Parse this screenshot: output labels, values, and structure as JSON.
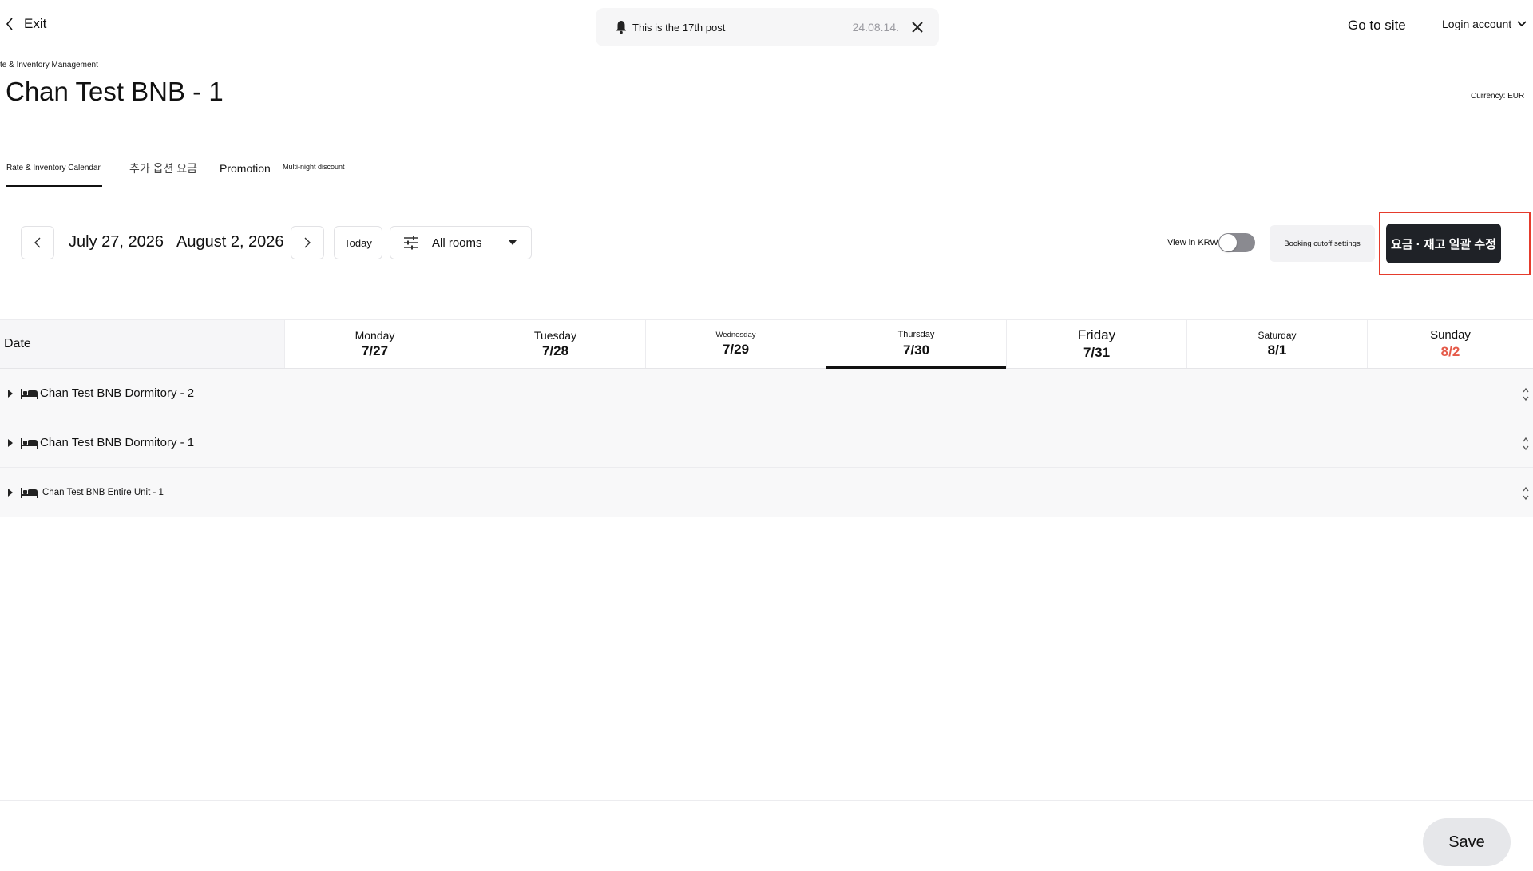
{
  "header": {
    "exit_label": "Exit",
    "notice_text": "This is the 17th post",
    "notice_date": "24.08.14.",
    "go_to_site": "Go to site",
    "login_account": "Login account"
  },
  "page": {
    "breadcrumb": "te & Inventory Management",
    "title": "Chan Test BNB - 1",
    "currency": "Currency: EUR"
  },
  "tabs": [
    {
      "label": "Rate & Inventory Calendar",
      "active": true
    },
    {
      "label": "추가 옵션 요금"
    },
    {
      "label": "Promotion"
    },
    {
      "label": "Multi-night discount"
    }
  ],
  "toolbar": {
    "range_start": "July 27, 2026",
    "range_end": "August 2, 2026",
    "today_label": "Today",
    "rooms_label": "All rooms",
    "view_krw_label": "View in KRW",
    "view_krw_on": false,
    "cutoff_label": "Booking cutoff settings",
    "bulk_edit_label": "요금 · 재고 일괄 수정"
  },
  "grid": {
    "date_header": "Date",
    "days": [
      {
        "name": "Monday",
        "date": "7/27"
      },
      {
        "name": "Tuesday",
        "date": "7/28"
      },
      {
        "name": "Wednesday",
        "date": "7/29"
      },
      {
        "name": "Thursday",
        "date": "7/30",
        "selected": true
      },
      {
        "name": "Friday",
        "date": "7/31"
      },
      {
        "name": "Saturday",
        "date": "8/1"
      },
      {
        "name": "Sunday",
        "date": "8/2"
      }
    ],
    "rooms": [
      {
        "name": "Chan Test BNB Dormitory - 2"
      },
      {
        "name": "Chan Test BNB Dormitory - 1"
      },
      {
        "name": "Chan Test BNB Entire Unit - 1"
      }
    ]
  },
  "footer": {
    "save_label": "Save"
  },
  "colors": {
    "accent_dark": "#1f2227",
    "sunday_red": "#e55a49",
    "highlight_red": "#e53b2c"
  }
}
